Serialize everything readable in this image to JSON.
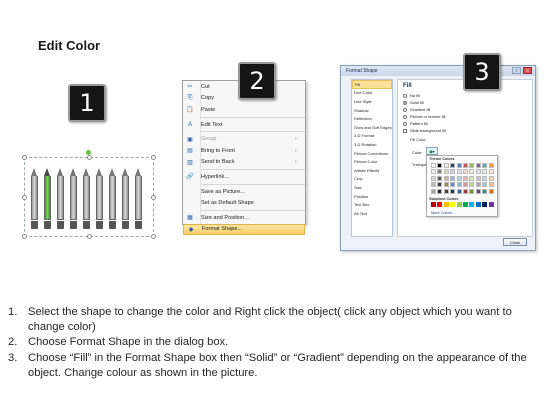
{
  "title": "Edit Color",
  "step_numbers": [
    "1",
    "2",
    "3"
  ],
  "context_menu": {
    "items": [
      {
        "icon": "scissors-icon",
        "glyph": "✂",
        "label": "Cut",
        "arrow": ""
      },
      {
        "icon": "copy-icon",
        "glyph": "⎘",
        "label": "Copy",
        "arrow": ""
      },
      {
        "icon": "paste-icon",
        "glyph": "📋",
        "label": "Paste",
        "arrow": ""
      },
      {
        "icon": "edit-text-icon",
        "glyph": "A",
        "label": "Edit Text",
        "arrow": ""
      },
      {
        "icon": "group-icon",
        "glyph": "▣",
        "label": "Group",
        "arrow": "›"
      },
      {
        "icon": "bring-front-icon",
        "glyph": "▤",
        "label": "Bring to Front",
        "arrow": "›"
      },
      {
        "icon": "send-back-icon",
        "glyph": "▥",
        "label": "Send to Back",
        "arrow": "›"
      },
      {
        "icon": "hyperlink-icon",
        "glyph": "🔗",
        "label": "Hyperlink...",
        "arrow": ""
      },
      {
        "icon": "save-picture-icon",
        "glyph": "",
        "label": "Save as Picture...",
        "arrow": ""
      },
      {
        "icon": "default-shape-icon",
        "glyph": "",
        "label": "Set as Default Shape",
        "arrow": ""
      },
      {
        "icon": "size-position-icon",
        "glyph": "▦",
        "label": "Size and Position...",
        "arrow": ""
      },
      {
        "icon": "format-shape-icon",
        "glyph": "◆",
        "label": "Format Shape...",
        "arrow": ""
      }
    ]
  },
  "format_shape": {
    "title": "Format Shape",
    "nav": [
      "Fill",
      "Line Color",
      "Line Style",
      "Shadow",
      "Reflection",
      "Glow and Soft Edges",
      "3-D Format",
      "3-D Rotation",
      "Picture Corrections",
      "Picture Color",
      "Artistic Effects",
      "Crop",
      "Size",
      "Position",
      "Text Box",
      "Alt Text"
    ],
    "heading": "Fill",
    "options": [
      "No fill",
      "Solid fill",
      "Gradient fill",
      "Picture or texture fill",
      "Pattern fill",
      "Slide background fill"
    ],
    "fill_color_label": "Fill Color",
    "color_label": "Color:",
    "transparency_label": "Transpa",
    "theme_colors_label": "Theme Colors",
    "standard_colors_label": "Standard Colors",
    "more_colors_label": "More Colors...",
    "close_label": "Close",
    "theme_colors": [
      "#ffffff",
      "#000000",
      "#eeece1",
      "#1f497d",
      "#4f81bd",
      "#c0504d",
      "#9bbb59",
      "#8064a2",
      "#4bacc6",
      "#f79646",
      "#f2f2f2",
      "#7f7f7f",
      "#ddd9c3",
      "#c6d9f0",
      "#dbe5f1",
      "#f2dcdb",
      "#ebf1dd",
      "#e5e0ec",
      "#dbeef3",
      "#fdeada",
      "#d8d8d8",
      "#595959",
      "#c4bd97",
      "#8db3e2",
      "#b8cce4",
      "#e5b9b7",
      "#d7e3bc",
      "#ccc1d9",
      "#b7dde8",
      "#fbd5b5",
      "#bfbfbf",
      "#3f3f3f",
      "#938953",
      "#548dd4",
      "#95b3d7",
      "#d99694",
      "#c3d69b",
      "#b2a2c7",
      "#92cddc",
      "#fac08f",
      "#a5a5a5",
      "#262626",
      "#494429",
      "#17365d",
      "#366092",
      "#953734",
      "#76923c",
      "#5f497a",
      "#31859b",
      "#e36c09"
    ],
    "standard_colors": [
      "#c00000",
      "#ff0000",
      "#ffc000",
      "#ffff00",
      "#92d050",
      "#00b050",
      "#00b0f0",
      "#0070c0",
      "#002060",
      "#7030a0"
    ]
  },
  "instructions": [
    {
      "num": "1.",
      "text": "Select the shape to change the color and Right click the object( click any object which you want to change color)"
    },
    {
      "num": "2.",
      "text": "Choose Format Shape in the dialog box."
    },
    {
      "num": "3.",
      "text": "Choose “Fill” in the Format Shape box then “Solid” or “Gradient” depending on the appearance of the object. Change colour as shown in the picture."
    }
  ]
}
